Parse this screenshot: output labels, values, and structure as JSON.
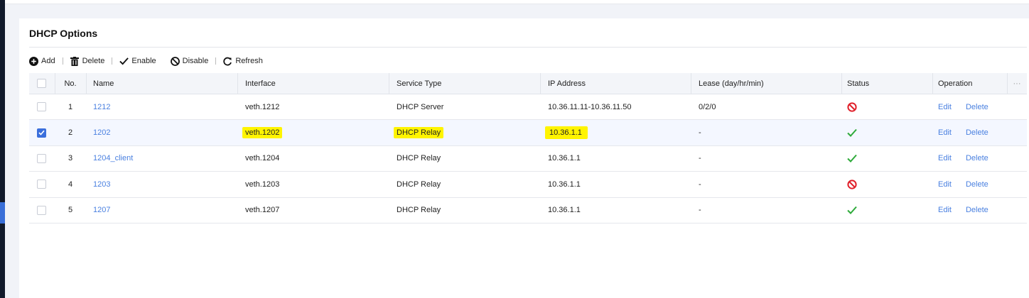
{
  "page": {
    "title": "DHCP Options"
  },
  "toolbar": {
    "add": "Add",
    "delete": "Delete",
    "enable": "Enable",
    "disable": "Disable",
    "refresh": "Refresh"
  },
  "table": {
    "columns": {
      "no": "No.",
      "name": "Name",
      "interface": "Interface",
      "service_type": "Service Type",
      "ip": "IP Address",
      "lease": "Lease (day/hr/min)",
      "status": "Status",
      "operation": "Operation"
    },
    "more": "···",
    "rows": [
      {
        "no": "1",
        "name": "1212",
        "interface": "veth.1212",
        "service_type": "DHCP Server",
        "ip": "10.36.11.11-10.36.11.50",
        "lease": "0/2/0",
        "status": "disabled",
        "checked": false,
        "edit": "Edit",
        "delete": "Delete"
      },
      {
        "no": "2",
        "name": "1202",
        "interface": "veth.1202",
        "service_type": "DHCP Relay",
        "ip": "10.36.1.1",
        "lease": "-",
        "status": "enabled",
        "checked": true,
        "edit": "Edit",
        "delete": "Delete"
      },
      {
        "no": "3",
        "name": "1204_client",
        "interface": "veth.1204",
        "service_type": "DHCP Relay",
        "ip": "10.36.1.1",
        "lease": "-",
        "status": "enabled",
        "checked": false,
        "edit": "Edit",
        "delete": "Delete"
      },
      {
        "no": "4",
        "name": "1203",
        "interface": "veth.1203",
        "service_type": "DHCP Relay",
        "ip": "10.36.1.1",
        "lease": "-",
        "status": "disabled",
        "checked": false,
        "edit": "Edit",
        "delete": "Delete"
      },
      {
        "no": "5",
        "name": "1207",
        "interface": "veth.1207",
        "service_type": "DHCP Relay",
        "ip": "10.36.1.1",
        "lease": "-",
        "status": "enabled",
        "checked": false,
        "edit": "Edit",
        "delete": "Delete"
      }
    ]
  },
  "colors": {
    "link": "#4a80e0",
    "highlight": "#fff400",
    "enabled": "#2eaa3a",
    "disabled": "#e0202a",
    "checkbox_on": "#3b6fdc"
  }
}
